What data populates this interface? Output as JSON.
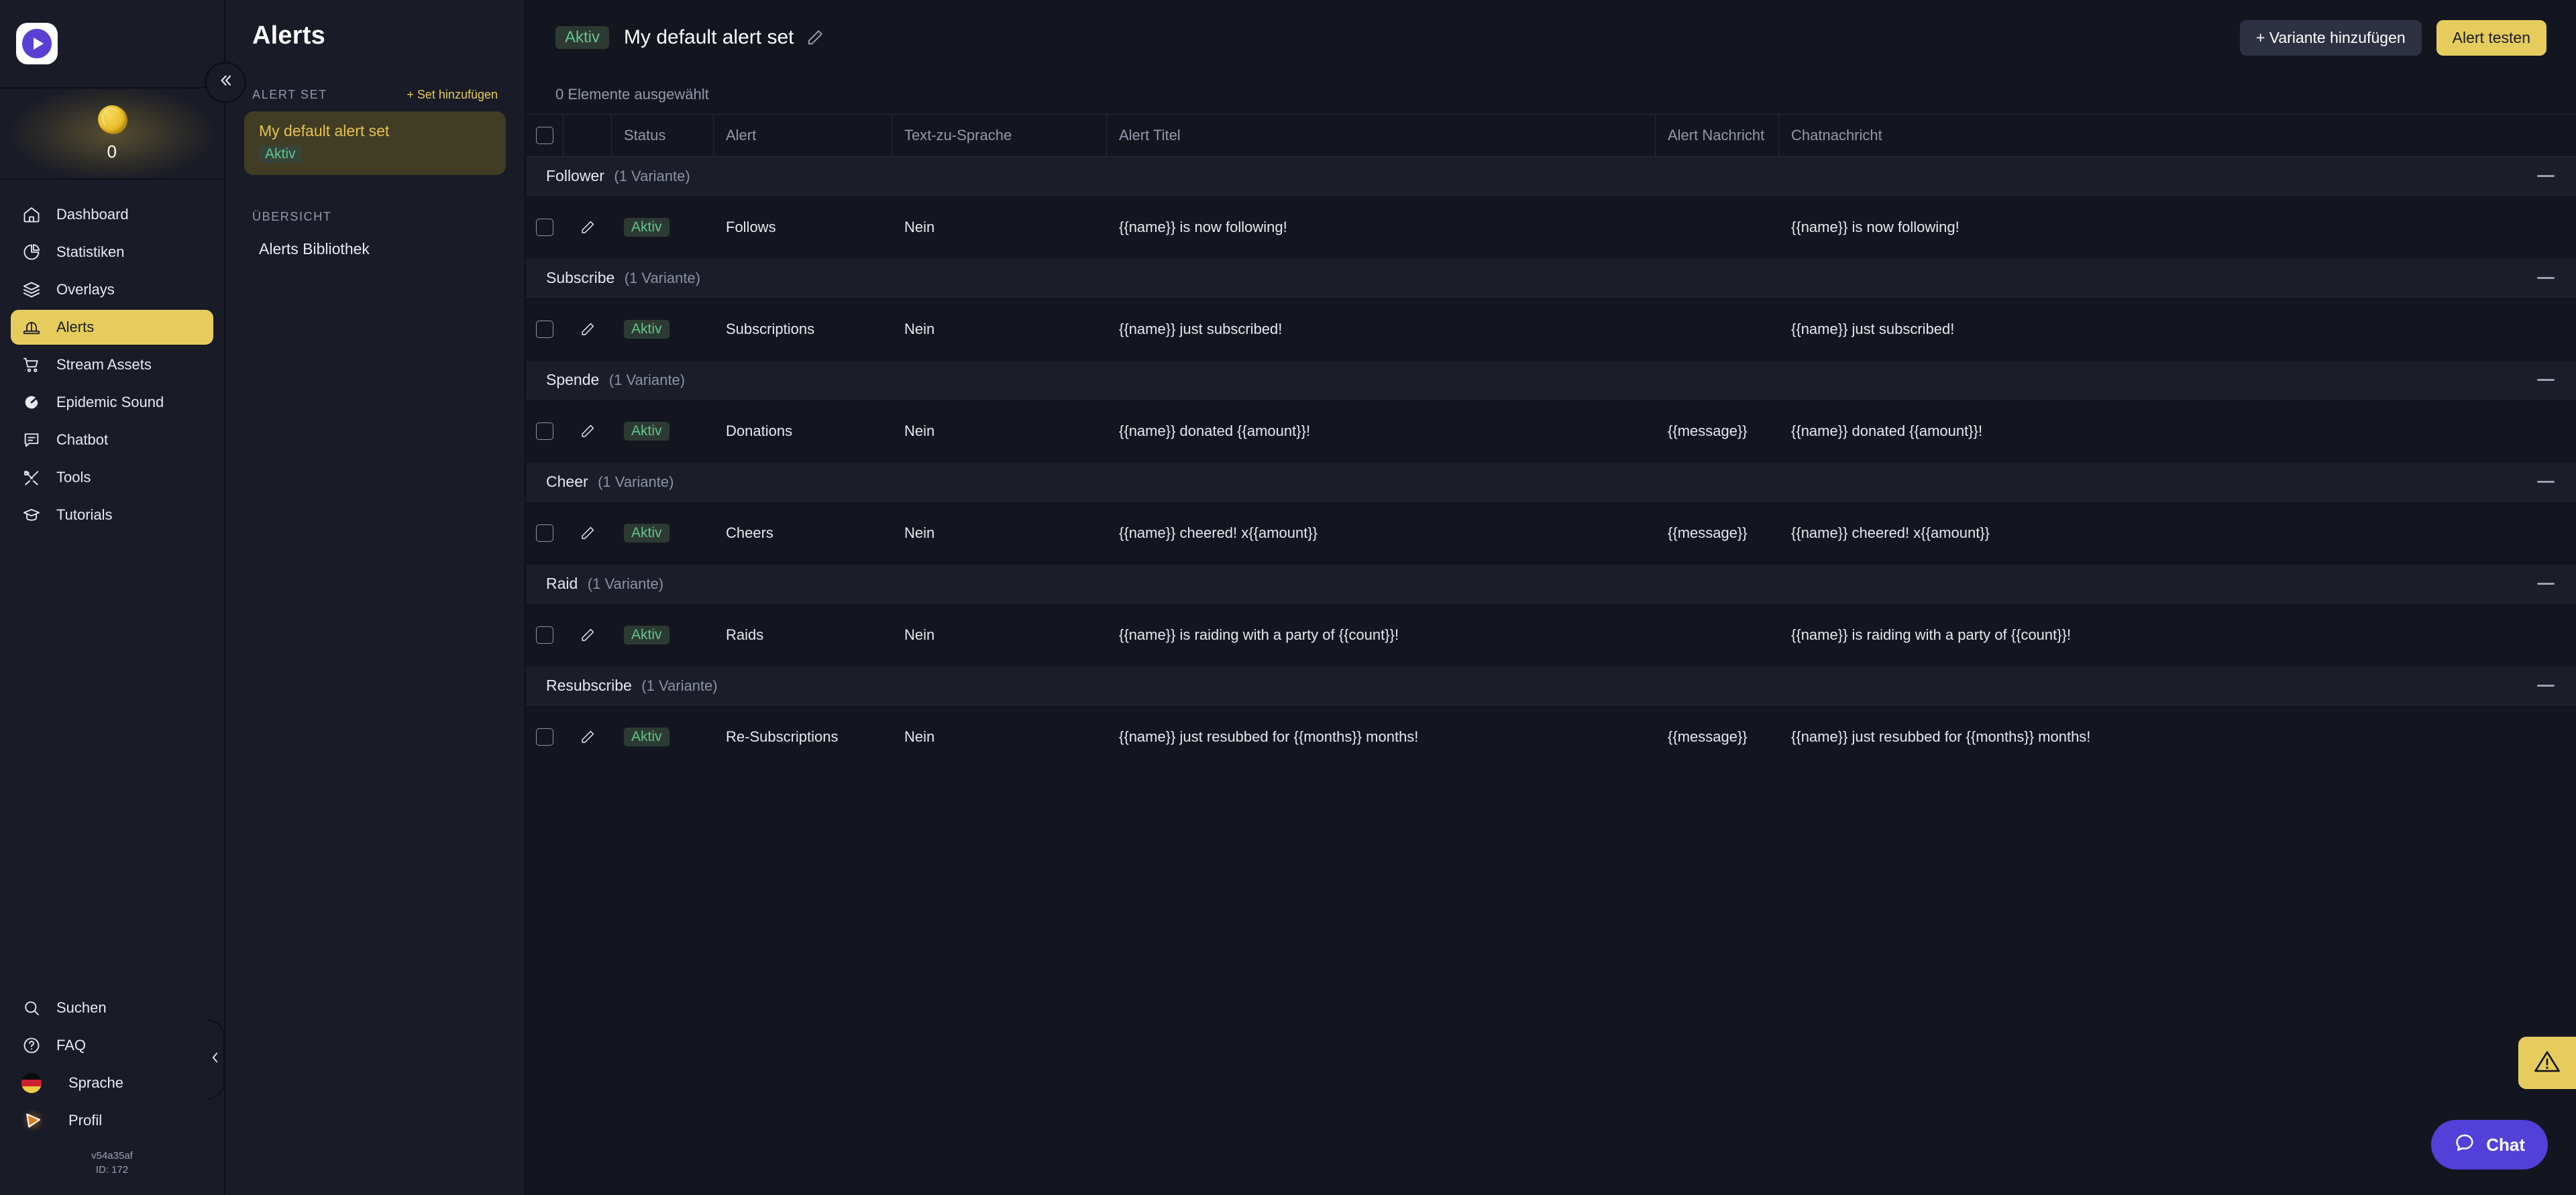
{
  "app": {
    "logo_icon": "play-logo-icon",
    "coin_icon": "coin-icon",
    "coin_count": "0"
  },
  "sidebar": {
    "items": [
      {
        "label": "Dashboard",
        "icon": "home-icon",
        "active": false
      },
      {
        "label": "Statistiken",
        "icon": "pie-chart-icon",
        "active": false
      },
      {
        "label": "Overlays",
        "icon": "layers-icon",
        "active": false
      },
      {
        "label": "Alerts",
        "icon": "siren-icon",
        "active": true
      },
      {
        "label": "Stream Assets",
        "icon": "cart-icon",
        "active": false
      },
      {
        "label": "Epidemic Sound",
        "icon": "epidemic-icon",
        "active": false
      },
      {
        "label": "Chatbot",
        "icon": "chat-bubble-icon",
        "active": false
      },
      {
        "label": "Tools",
        "icon": "tools-icon",
        "active": false
      },
      {
        "label": "Tutorials",
        "icon": "graduation-cap-icon",
        "active": false
      }
    ],
    "bottom": [
      {
        "label": "Suchen",
        "icon": "search-icon"
      },
      {
        "label": "FAQ",
        "icon": "question-circle-icon"
      },
      {
        "label": "Sprache",
        "icon": "german-flag-icon"
      },
      {
        "label": "Profil",
        "icon": "profile-play-icon"
      }
    ],
    "version": "v54a35af",
    "user_id": "ID: 172",
    "collapse_icon": "chevron-left-icon"
  },
  "alerts_panel": {
    "title": "Alerts",
    "section_label": "ALERT SET",
    "add_set_label": "+ Set hinzufügen",
    "alert_set": {
      "name": "My default alert set",
      "status": "Aktiv"
    },
    "overview_label": "ÜBERSICHT",
    "library_link": "Alerts Bibliothek",
    "collapse_icon": "chevrons-left-icon"
  },
  "header": {
    "status_badge": "Aktiv",
    "title": "My default alert set",
    "edit_icon": "pencil-icon",
    "add_variant_label": "+ Variante hinzufügen",
    "test_alert_label": "Alert testen"
  },
  "table": {
    "selection_text": "0 Elemente ausgewählt",
    "columns": [
      "",
      "",
      "Status",
      "Alert",
      "Text-zu-Sprache",
      "Alert Titel",
      "Alert Nachricht",
      "Chatnachricht"
    ],
    "variant_suffix": "(1 Variante)",
    "groups": [
      {
        "name": "Follower",
        "count": "(1 Variante)",
        "rows": [
          {
            "status": "Aktiv",
            "alert": "Follows",
            "tts": "Nein",
            "alert_title": "{{name}} is now following!",
            "alert_message": "",
            "chat_message": "{{name}} is now following!"
          }
        ]
      },
      {
        "name": "Subscribe",
        "count": "(1 Variante)",
        "rows": [
          {
            "status": "Aktiv",
            "alert": "Subscriptions",
            "tts": "Nein",
            "alert_title": "{{name}} just subscribed!",
            "alert_message": "",
            "chat_message": "{{name}} just subscribed!"
          }
        ]
      },
      {
        "name": "Spende",
        "count": "(1 Variante)",
        "rows": [
          {
            "status": "Aktiv",
            "alert": "Donations",
            "tts": "Nein",
            "alert_title": "{{name}} donated {{amount}}!",
            "alert_message": "{{message}}",
            "chat_message": "{{name}} donated {{amount}}!"
          }
        ]
      },
      {
        "name": "Cheer",
        "count": "(1 Variante)",
        "rows": [
          {
            "status": "Aktiv",
            "alert": "Cheers",
            "tts": "Nein",
            "alert_title": "{{name}} cheered! x{{amount}}",
            "alert_message": "{{message}}",
            "chat_message": "{{name}} cheered! x{{amount}}"
          }
        ]
      },
      {
        "name": "Raid",
        "count": "(1 Variante)",
        "rows": [
          {
            "status": "Aktiv",
            "alert": "Raids",
            "tts": "Nein",
            "alert_title": "{{name}} is raiding with a party of {{count}}!",
            "alert_message": "",
            "chat_message": "{{name}} is raiding with a party of {{count}}!"
          }
        ]
      },
      {
        "name": "Resubscribe",
        "count": "(1 Variante)",
        "rows": [
          {
            "status": "Aktiv",
            "alert": "Re-Subscriptions",
            "tts": "Nein",
            "alert_title": "{{name}} just resubbed for {{months}} months!",
            "alert_message": "{{message}}",
            "chat_message": "{{name}} just resubbed for {{months}} months!"
          }
        ]
      }
    ]
  },
  "floating": {
    "warning_icon": "warning-triangle-icon",
    "chat_label": "Chat",
    "chat_icon": "chat-bubble-icon"
  },
  "colors": {
    "accent": "#e6cc5d",
    "active_green": "#62c58c",
    "chat_purple": "#5340d8",
    "bg": "#14161f",
    "panel_bg": "#191b26"
  }
}
